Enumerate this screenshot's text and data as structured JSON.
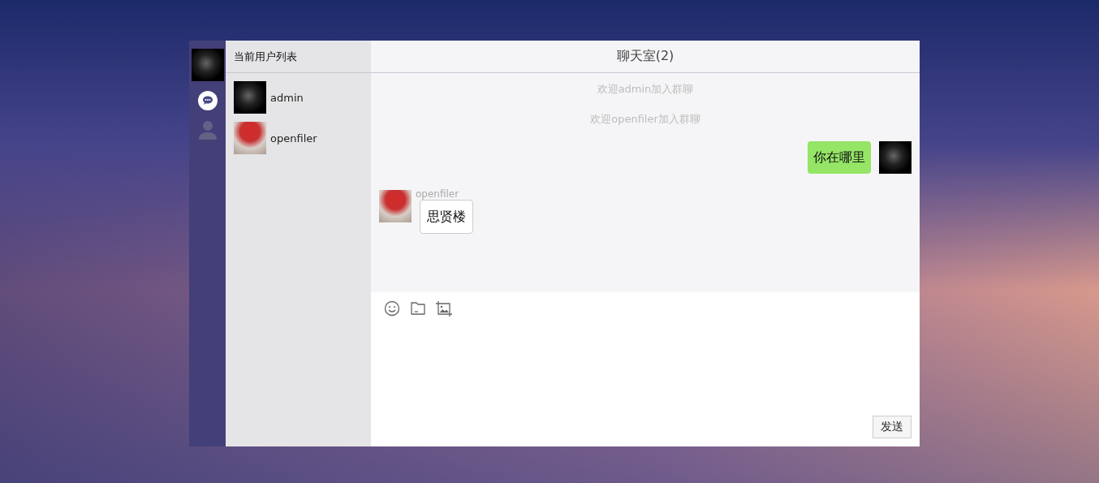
{
  "nav": {
    "avatar": {
      "kind": "dark-portrait"
    },
    "items": [
      {
        "kind": "chat",
        "selected": true
      },
      {
        "kind": "contacts",
        "selected": false
      }
    ]
  },
  "user_list": {
    "title": "当前用户列表",
    "users": [
      {
        "name": "admin",
        "avatar": {
          "kind": "dark-portrait"
        }
      },
      {
        "name": "openfiler",
        "avatar": {
          "kind": "red-flower"
        }
      }
    ]
  },
  "chat": {
    "title": "聊天室(2)",
    "messages": [
      {
        "kind": "system",
        "text": "欢迎admin加入群聊"
      },
      {
        "kind": "system",
        "text": "欢迎openfiler加入群聊"
      },
      {
        "kind": "outgoing",
        "text": "你在哪里",
        "avatar": {
          "kind": "dark-portrait"
        }
      },
      {
        "kind": "incoming",
        "sender": "openfiler",
        "text": "思贤楼",
        "avatar": {
          "kind": "red-flower"
        }
      }
    ]
  },
  "composer": {
    "tools": [
      {
        "kind": "emoji"
      },
      {
        "kind": "file"
      },
      {
        "kind": "image"
      }
    ],
    "send_button": "发送"
  }
}
